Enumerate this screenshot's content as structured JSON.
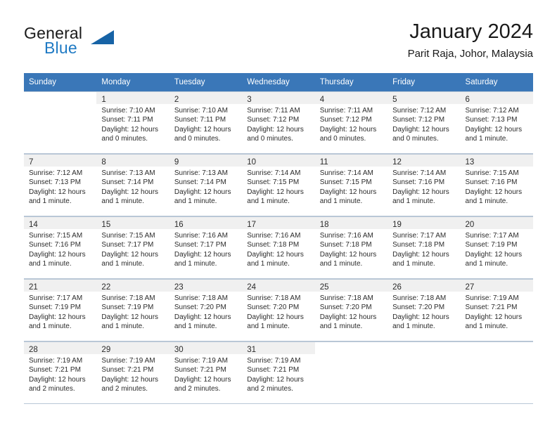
{
  "brand": {
    "word1": "General",
    "word2": "Blue",
    "logo_icon": "triangle-logo-icon",
    "color_dark": "#1a1a1a",
    "color_blue": "#1f7ac4",
    "color_triangle": "#1763a6"
  },
  "header": {
    "title": "January 2024",
    "subtitle": "Parit Raja, Johor, Malaysia"
  },
  "calendar": {
    "header_bg": "#3a77b8",
    "header_text_color": "#ffffff",
    "weekdays": [
      "Sunday",
      "Monday",
      "Tuesday",
      "Wednesday",
      "Thursday",
      "Friday",
      "Saturday"
    ],
    "weeks": [
      [
        {
          "day": "",
          "sunrise": "",
          "sunset": "",
          "daylight1": "",
          "daylight2": "",
          "empty": true
        },
        {
          "day": "1",
          "sunrise": "Sunrise: 7:10 AM",
          "sunset": "Sunset: 7:11 PM",
          "daylight1": "Daylight: 12 hours",
          "daylight2": "and 0 minutes.",
          "empty": false
        },
        {
          "day": "2",
          "sunrise": "Sunrise: 7:10 AM",
          "sunset": "Sunset: 7:11 PM",
          "daylight1": "Daylight: 12 hours",
          "daylight2": "and 0 minutes.",
          "empty": false
        },
        {
          "day": "3",
          "sunrise": "Sunrise: 7:11 AM",
          "sunset": "Sunset: 7:12 PM",
          "daylight1": "Daylight: 12 hours",
          "daylight2": "and 0 minutes.",
          "empty": false
        },
        {
          "day": "4",
          "sunrise": "Sunrise: 7:11 AM",
          "sunset": "Sunset: 7:12 PM",
          "daylight1": "Daylight: 12 hours",
          "daylight2": "and 0 minutes.",
          "empty": false
        },
        {
          "day": "5",
          "sunrise": "Sunrise: 7:12 AM",
          "sunset": "Sunset: 7:12 PM",
          "daylight1": "Daylight: 12 hours",
          "daylight2": "and 0 minutes.",
          "empty": false
        },
        {
          "day": "6",
          "sunrise": "Sunrise: 7:12 AM",
          "sunset": "Sunset: 7:13 PM",
          "daylight1": "Daylight: 12 hours",
          "daylight2": "and 1 minute.",
          "empty": false
        }
      ],
      [
        {
          "day": "7",
          "sunrise": "Sunrise: 7:12 AM",
          "sunset": "Sunset: 7:13 PM",
          "daylight1": "Daylight: 12 hours",
          "daylight2": "and 1 minute.",
          "empty": false
        },
        {
          "day": "8",
          "sunrise": "Sunrise: 7:13 AM",
          "sunset": "Sunset: 7:14 PM",
          "daylight1": "Daylight: 12 hours",
          "daylight2": "and 1 minute.",
          "empty": false
        },
        {
          "day": "9",
          "sunrise": "Sunrise: 7:13 AM",
          "sunset": "Sunset: 7:14 PM",
          "daylight1": "Daylight: 12 hours",
          "daylight2": "and 1 minute.",
          "empty": false
        },
        {
          "day": "10",
          "sunrise": "Sunrise: 7:14 AM",
          "sunset": "Sunset: 7:15 PM",
          "daylight1": "Daylight: 12 hours",
          "daylight2": "and 1 minute.",
          "empty": false
        },
        {
          "day": "11",
          "sunrise": "Sunrise: 7:14 AM",
          "sunset": "Sunset: 7:15 PM",
          "daylight1": "Daylight: 12 hours",
          "daylight2": "and 1 minute.",
          "empty": false
        },
        {
          "day": "12",
          "sunrise": "Sunrise: 7:14 AM",
          "sunset": "Sunset: 7:16 PM",
          "daylight1": "Daylight: 12 hours",
          "daylight2": "and 1 minute.",
          "empty": false
        },
        {
          "day": "13",
          "sunrise": "Sunrise: 7:15 AM",
          "sunset": "Sunset: 7:16 PM",
          "daylight1": "Daylight: 12 hours",
          "daylight2": "and 1 minute.",
          "empty": false
        }
      ],
      [
        {
          "day": "14",
          "sunrise": "Sunrise: 7:15 AM",
          "sunset": "Sunset: 7:16 PM",
          "daylight1": "Daylight: 12 hours",
          "daylight2": "and 1 minute.",
          "empty": false
        },
        {
          "day": "15",
          "sunrise": "Sunrise: 7:15 AM",
          "sunset": "Sunset: 7:17 PM",
          "daylight1": "Daylight: 12 hours",
          "daylight2": "and 1 minute.",
          "empty": false
        },
        {
          "day": "16",
          "sunrise": "Sunrise: 7:16 AM",
          "sunset": "Sunset: 7:17 PM",
          "daylight1": "Daylight: 12 hours",
          "daylight2": "and 1 minute.",
          "empty": false
        },
        {
          "day": "17",
          "sunrise": "Sunrise: 7:16 AM",
          "sunset": "Sunset: 7:18 PM",
          "daylight1": "Daylight: 12 hours",
          "daylight2": "and 1 minute.",
          "empty": false
        },
        {
          "day": "18",
          "sunrise": "Sunrise: 7:16 AM",
          "sunset": "Sunset: 7:18 PM",
          "daylight1": "Daylight: 12 hours",
          "daylight2": "and 1 minute.",
          "empty": false
        },
        {
          "day": "19",
          "sunrise": "Sunrise: 7:17 AM",
          "sunset": "Sunset: 7:18 PM",
          "daylight1": "Daylight: 12 hours",
          "daylight2": "and 1 minute.",
          "empty": false
        },
        {
          "day": "20",
          "sunrise": "Sunrise: 7:17 AM",
          "sunset": "Sunset: 7:19 PM",
          "daylight1": "Daylight: 12 hours",
          "daylight2": "and 1 minute.",
          "empty": false
        }
      ],
      [
        {
          "day": "21",
          "sunrise": "Sunrise: 7:17 AM",
          "sunset": "Sunset: 7:19 PM",
          "daylight1": "Daylight: 12 hours",
          "daylight2": "and 1 minute.",
          "empty": false
        },
        {
          "day": "22",
          "sunrise": "Sunrise: 7:18 AM",
          "sunset": "Sunset: 7:19 PM",
          "daylight1": "Daylight: 12 hours",
          "daylight2": "and 1 minute.",
          "empty": false
        },
        {
          "day": "23",
          "sunrise": "Sunrise: 7:18 AM",
          "sunset": "Sunset: 7:20 PM",
          "daylight1": "Daylight: 12 hours",
          "daylight2": "and 1 minute.",
          "empty": false
        },
        {
          "day": "24",
          "sunrise": "Sunrise: 7:18 AM",
          "sunset": "Sunset: 7:20 PM",
          "daylight1": "Daylight: 12 hours",
          "daylight2": "and 1 minute.",
          "empty": false
        },
        {
          "day": "25",
          "sunrise": "Sunrise: 7:18 AM",
          "sunset": "Sunset: 7:20 PM",
          "daylight1": "Daylight: 12 hours",
          "daylight2": "and 1 minute.",
          "empty": false
        },
        {
          "day": "26",
          "sunrise": "Sunrise: 7:18 AM",
          "sunset": "Sunset: 7:20 PM",
          "daylight1": "Daylight: 12 hours",
          "daylight2": "and 1 minute.",
          "empty": false
        },
        {
          "day": "27",
          "sunrise": "Sunrise: 7:19 AM",
          "sunset": "Sunset: 7:21 PM",
          "daylight1": "Daylight: 12 hours",
          "daylight2": "and 1 minute.",
          "empty": false
        }
      ],
      [
        {
          "day": "28",
          "sunrise": "Sunrise: 7:19 AM",
          "sunset": "Sunset: 7:21 PM",
          "daylight1": "Daylight: 12 hours",
          "daylight2": "and 2 minutes.",
          "empty": false
        },
        {
          "day": "29",
          "sunrise": "Sunrise: 7:19 AM",
          "sunset": "Sunset: 7:21 PM",
          "daylight1": "Daylight: 12 hours",
          "daylight2": "and 2 minutes.",
          "empty": false
        },
        {
          "day": "30",
          "sunrise": "Sunrise: 7:19 AM",
          "sunset": "Sunset: 7:21 PM",
          "daylight1": "Daylight: 12 hours",
          "daylight2": "and 2 minutes.",
          "empty": false
        },
        {
          "day": "31",
          "sunrise": "Sunrise: 7:19 AM",
          "sunset": "Sunset: 7:21 PM",
          "daylight1": "Daylight: 12 hours",
          "daylight2": "and 2 minutes.",
          "empty": false
        },
        {
          "day": "",
          "sunrise": "",
          "sunset": "",
          "daylight1": "",
          "daylight2": "",
          "empty": true
        },
        {
          "day": "",
          "sunrise": "",
          "sunset": "",
          "daylight1": "",
          "daylight2": "",
          "empty": true
        },
        {
          "day": "",
          "sunrise": "",
          "sunset": "",
          "daylight1": "",
          "daylight2": "",
          "empty": true
        }
      ]
    ]
  }
}
